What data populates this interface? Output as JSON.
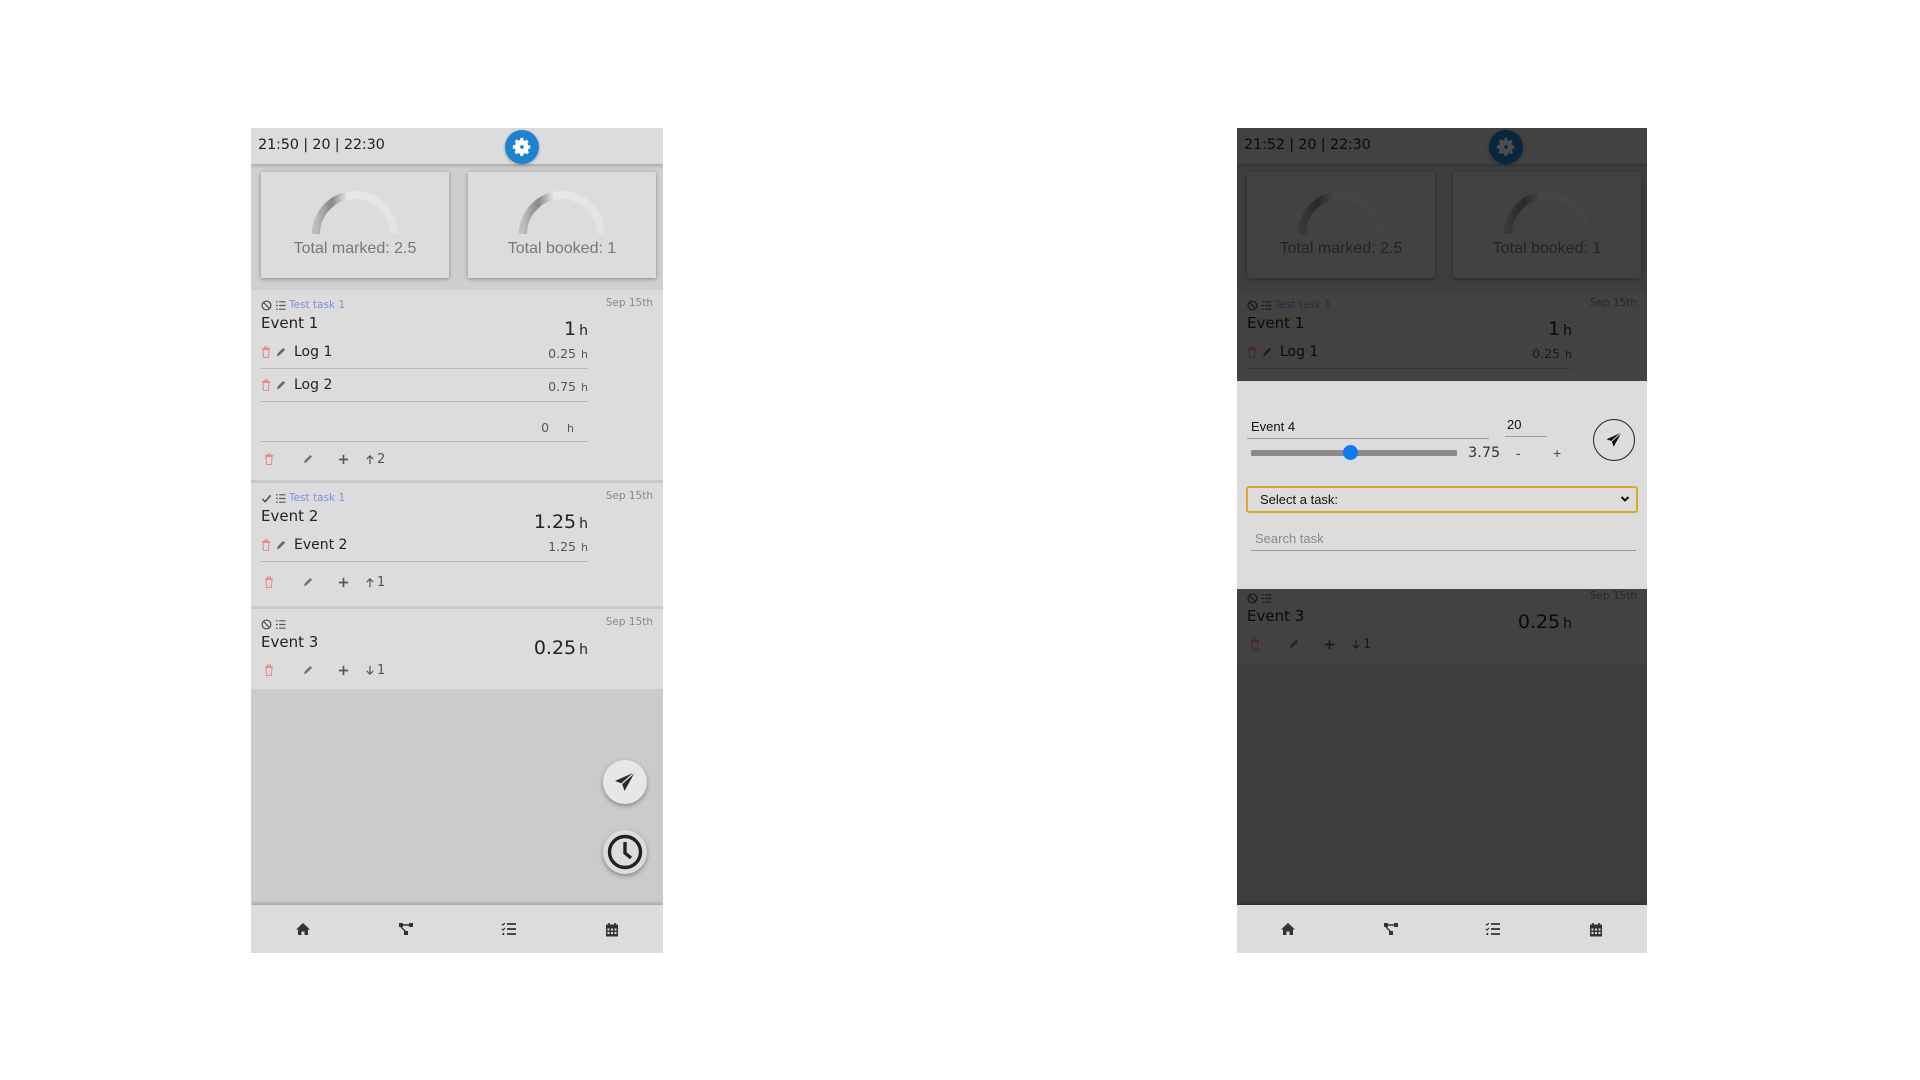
{
  "screens": [
    {
      "header": {
        "times": "21:50 | 20 | 22:30"
      },
      "stats": {
        "marked_label": "Total marked: 2.5",
        "booked_label": "Total booked: 1"
      },
      "events": [
        {
          "status": "blocked",
          "task": "Test task 1",
          "date": "Sep 15th",
          "title": "Event 1",
          "total": "1",
          "unit": "h",
          "logs": [
            {
              "name": "Log 1",
              "hours": "0.25",
              "unit": "h"
            },
            {
              "name": "Log 2",
              "hours": "0.75",
              "unit": "h"
            }
          ],
          "new_log": {
            "hours": "0",
            "unit": "h"
          },
          "move": {
            "direction": "up",
            "count": "2"
          }
        },
        {
          "status": "done",
          "task": "Test task 1",
          "date": "Sep 15th",
          "title": "Event 2",
          "total": "1.25",
          "unit": "h",
          "logs": [
            {
              "name": "Event 2",
              "hours": "1.25",
              "unit": "h"
            }
          ],
          "move": {
            "direction": "up",
            "count": "1"
          }
        },
        {
          "status": "blocked",
          "task": "",
          "date": "Sep 15th",
          "title": "Event 3",
          "total": "0.25",
          "unit": "h",
          "logs": [],
          "move": {
            "direction": "down",
            "count": "1"
          }
        }
      ],
      "fabs": [
        "send-icon",
        "clock-icon"
      ],
      "nav": [
        "home-icon",
        "network-icon",
        "tasks-icon",
        "calendar-icon"
      ]
    },
    {
      "header": {
        "times": "21:52 | 20 | 22:30"
      },
      "stats": {
        "marked_label": "Total marked: 2.5",
        "booked_label": "Total booked: 1"
      },
      "events": [
        {
          "status": "blocked",
          "task": "Test task 1",
          "date": "Sep 15th",
          "title": "Event 1",
          "total": "1",
          "unit": "h",
          "logs": [
            {
              "name": "Log 1",
              "hours": "0.25",
              "unit": "h"
            }
          ]
        },
        {
          "status": "blocked",
          "task": "",
          "date": "Sep 15th",
          "title": "Event 3",
          "total": "0.25",
          "unit": "h",
          "logs": [],
          "move": {
            "direction": "down",
            "count": "1"
          }
        }
      ],
      "dialog": {
        "name_value": "Event 4",
        "minutes_value": "20",
        "hours_slider_fraction": 0.48,
        "hours_value": "3.75",
        "minus_label": "-",
        "plus_label": "+",
        "select_label": "Select a task:",
        "search_placeholder": "Search task"
      },
      "nav": [
        "home-icon",
        "network-icon",
        "tasks-icon",
        "calendar-icon"
      ]
    }
  ],
  "colors": {
    "accent": "#1c84cf",
    "slider_thumb": "#0d7cf2",
    "task_link": "#7f8fe0",
    "delete": "#e88a8a",
    "select_focus": "#d8a82f"
  }
}
